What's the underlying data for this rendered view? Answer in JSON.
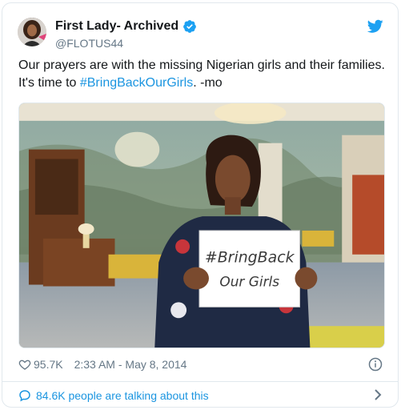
{
  "author": {
    "display_name": "First Lady- Archived",
    "handle": "@FLOTUS44",
    "verified": true
  },
  "tweet": {
    "text_part1": "Our prayers are with the missing Nigerian girls and their families. It's time to ",
    "hashtag": "#BringBackOurGirls",
    "text_part2": ". -mo"
  },
  "photo": {
    "sign_line1": "#BringBack",
    "sign_line2": "Our Girls"
  },
  "footer": {
    "likes": "95.7K",
    "timestamp": "2:33 AM - May 8, 2014",
    "talking": "84.6K people are talking about this"
  },
  "colors": {
    "link": "#1b95e0",
    "secondary_text": "#657786",
    "border": "#e1e8ed"
  },
  "icons": [
    "verified-icon",
    "twitter-bird-icon",
    "heart-icon",
    "info-icon",
    "speech-bubble-icon",
    "chevron-right-icon"
  ]
}
